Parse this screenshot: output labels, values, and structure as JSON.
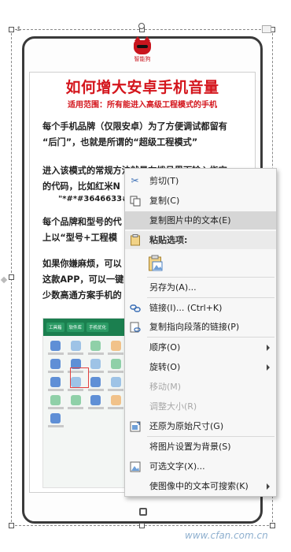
{
  "document": {
    "logo_text": "智能狗",
    "title": "如何增大安卓手机音量",
    "subtitle": "适用范围：所有能进入高级工程模式的手机",
    "paragraphs": [
      {
        "line1": "每个手机品牌（仅限安卓）为了方便调试都留有",
        "line2": "“后门”，也就是所谓的“超级工程模式”"
      },
      {
        "line1": "进入该模式的常规方法就是在拨号界面输入指定",
        "line2": "的代码，比如红米N",
        "line3": "\"*#*#3646633#*"
      },
      {
        "line1": "每个品牌和型号的代",
        "line2": "上以“型号+工程模"
      },
      {
        "line1": "如果你嫌麻烦，可以",
        "line2": "这款APP，可以一键",
        "line3": "少数高通方案手机的"
      }
    ],
    "app_screenshot": {
      "tabs": [
        "工具箱",
        "软件库",
        "手机优化"
      ]
    }
  },
  "context_menu": {
    "items": [
      {
        "icon": "scissors-icon",
        "label": "剪切(T)",
        "state": "normal"
      },
      {
        "icon": "copy-icon",
        "label": "复制(C)",
        "state": "normal"
      },
      {
        "icon": "",
        "label": "复制图片中的文本(E)",
        "state": "highlighted"
      },
      {
        "icon": "clipboard-icon",
        "label": "粘贴选项:",
        "state": "section"
      },
      {
        "icon": "paste-picture-icon",
        "label": "",
        "state": "paste-option"
      },
      {
        "icon": "",
        "label": "另存为(A)...",
        "state": "normal"
      },
      {
        "icon": "link-icon",
        "label": "链接(I)...  (Ctrl+K)",
        "state": "normal"
      },
      {
        "icon": "paragraph-link-icon",
        "label": "复制指向段落的链接(P)",
        "state": "normal"
      },
      {
        "icon": "",
        "label": "顺序(O)",
        "state": "submenu"
      },
      {
        "icon": "",
        "label": "旋转(O)",
        "state": "submenu"
      },
      {
        "icon": "",
        "label": "移动(M)",
        "state": "disabled"
      },
      {
        "icon": "",
        "label": "调整大小(R)",
        "state": "disabled"
      },
      {
        "icon": "restore-size-icon",
        "label": "还原为原始尺寸(G)",
        "state": "normal"
      },
      {
        "icon": "",
        "label": "将图片设置为背景(S)",
        "state": "normal"
      },
      {
        "icon": "alt-text-icon",
        "label": "可选文字(X)...",
        "state": "normal"
      },
      {
        "icon": "",
        "label": "使图像中的文本可搜索(K)",
        "state": "submenu"
      }
    ]
  },
  "watermark": "www.cfan.com.cn"
}
